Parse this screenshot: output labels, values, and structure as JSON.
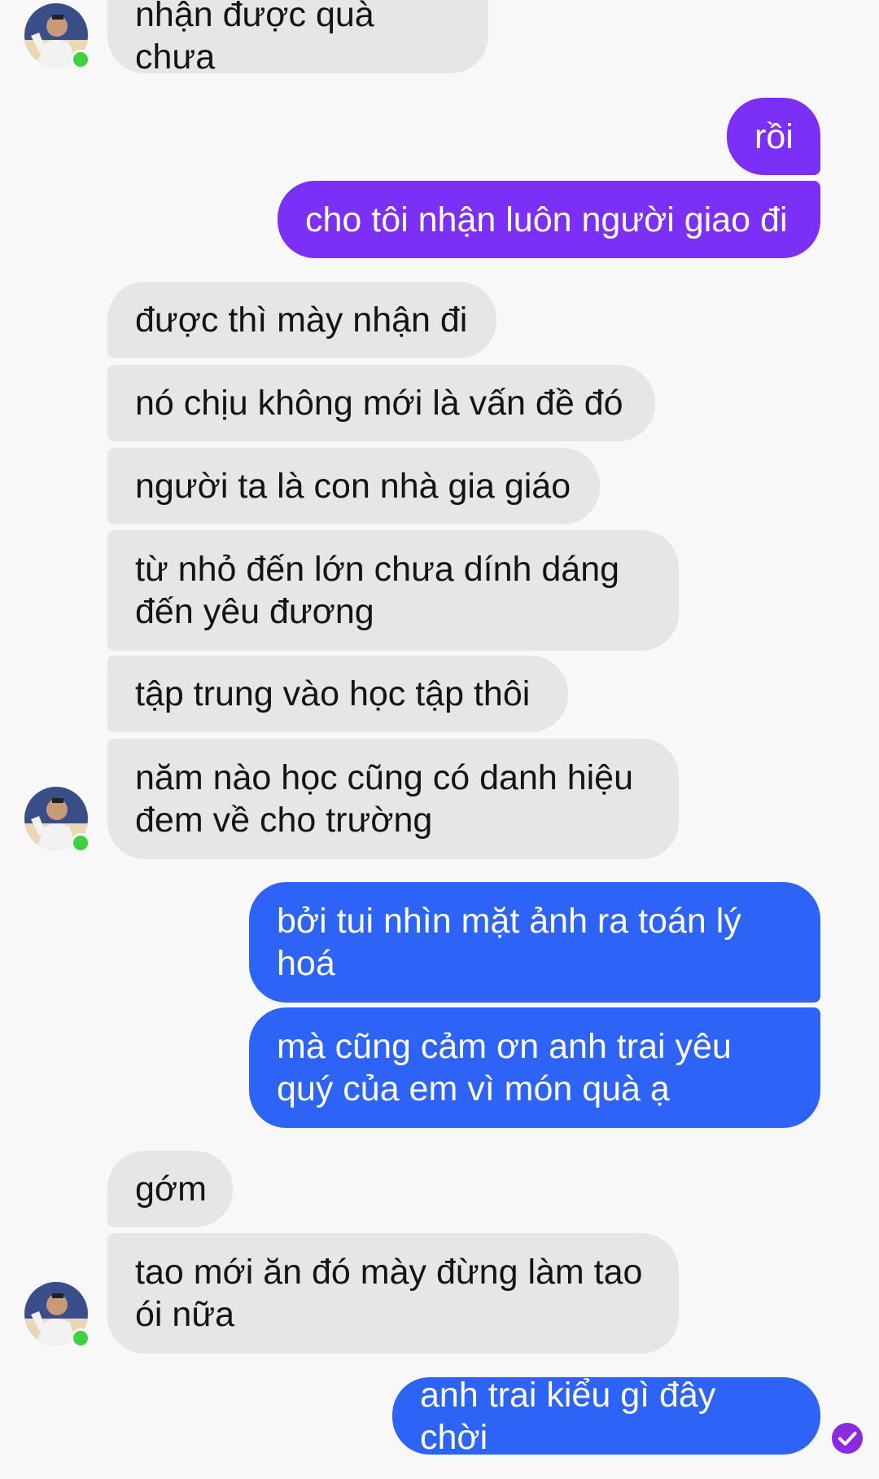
{
  "colors": {
    "incoming_bg": "#e6e6e6",
    "outgoing_purple": "#7b2ff7",
    "outgoing_blue": "#2d63f6",
    "online": "#3fd13f",
    "read_receipt": "#8a2be2"
  },
  "messages": [
    {
      "sender": "them",
      "text": "nhận được quà chưa"
    },
    {
      "sender": "me",
      "text": "rồi"
    },
    {
      "sender": "me",
      "text": "cho tôi nhận luôn người giao đi"
    },
    {
      "sender": "them",
      "text": "được thì mày nhận đi"
    },
    {
      "sender": "them",
      "text": "nó chịu không mới là vấn đề đó"
    },
    {
      "sender": "them",
      "text": "người ta là con nhà gia giáo"
    },
    {
      "sender": "them",
      "text": "từ nhỏ đến lớn chưa dính dáng đến yêu đương"
    },
    {
      "sender": "them",
      "text": "tập trung vào học tập thôi"
    },
    {
      "sender": "them",
      "text": "năm nào học cũng có danh hiệu đem về cho trường"
    },
    {
      "sender": "me",
      "text": "bởi tui nhìn mặt ảnh ra toán lý hoá"
    },
    {
      "sender": "me",
      "text": "mà cũng cảm ơn anh trai yêu quý của em vì món quà ạ"
    },
    {
      "sender": "them",
      "text": "gớm"
    },
    {
      "sender": "them",
      "text": "tao mới ăn đó mày đừng làm tao ói nữa"
    },
    {
      "sender": "me",
      "text": "anh trai kiểu gì đây chời"
    }
  ],
  "icons": {
    "avatar": "contact-avatar",
    "status": "online-indicator",
    "receipt": "check-circle-icon"
  }
}
